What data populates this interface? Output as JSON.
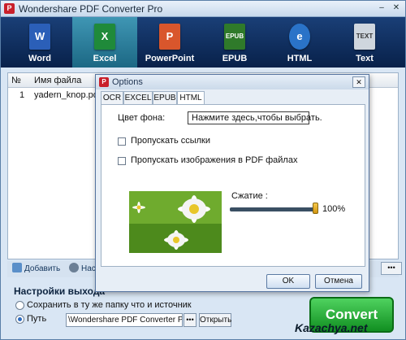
{
  "app": {
    "title": "Wondershare PDF Converter Pro",
    "icon_letter": "P"
  },
  "window_controls": {
    "minimize": "–",
    "close": "✕"
  },
  "toolbar": {
    "buttons": [
      {
        "label": "Word",
        "icon": "word-doc-icon",
        "icon_text": "W",
        "color": "#2b5fb8"
      },
      {
        "label": "Excel",
        "icon": "excel-sheet-icon",
        "icon_text": "X",
        "color": "#1f8a3a",
        "active": true
      },
      {
        "label": "PowerPoint",
        "icon": "powerpoint-icon",
        "icon_text": "P",
        "color": "#d9562c"
      },
      {
        "label": "EPUB",
        "icon": "epub-book-icon",
        "icon_text": "EPUB",
        "color": "#2f7a2a"
      },
      {
        "label": "HTML",
        "icon": "html-globe-icon",
        "icon_text": "e",
        "color": "#2a73c8"
      },
      {
        "label": "Text",
        "icon": "text-doc-icon",
        "icon_text": "TEXT",
        "color": "#cfd6de"
      }
    ]
  },
  "file_list": {
    "columns": {
      "num": "№",
      "name": "Имя файла"
    },
    "rows": [
      {
        "num": "1",
        "name": "yadern_knop.pdf"
      }
    ]
  },
  "bottom_bar": {
    "add_label": "Добавить",
    "settings_label": "Нас",
    "more_label": "•••"
  },
  "output": {
    "title": "Настройки выхода",
    "same_folder_label": "Сохранить в ту же папку что и источник",
    "path_label": "Путь",
    "path_value": "\\Wondershare PDF Converter Pro\\",
    "browse_label": "•••",
    "open_label": "Открыть",
    "convert_label": "Convert"
  },
  "watermark": "Kazachya.net",
  "dialog": {
    "title": "Options",
    "close": "✕",
    "tabs": [
      "OCR",
      "EXCEL",
      "EPUB",
      "HTML"
    ],
    "active_tab": "HTML",
    "bg_color_label": "Цвет фона:",
    "bg_color_value": "Нажмите здесь,чтобы выбрать.",
    "skip_links_label": "Пропускать ссылки",
    "skip_links_checked": false,
    "skip_images_label": "Пропускать изображения в PDF файлах",
    "skip_images_checked": false,
    "compression_label": "Сжатие :",
    "compression_value": "100%",
    "compression_level": 1.0,
    "ok_label": "OK",
    "cancel_label": "Отмена"
  }
}
